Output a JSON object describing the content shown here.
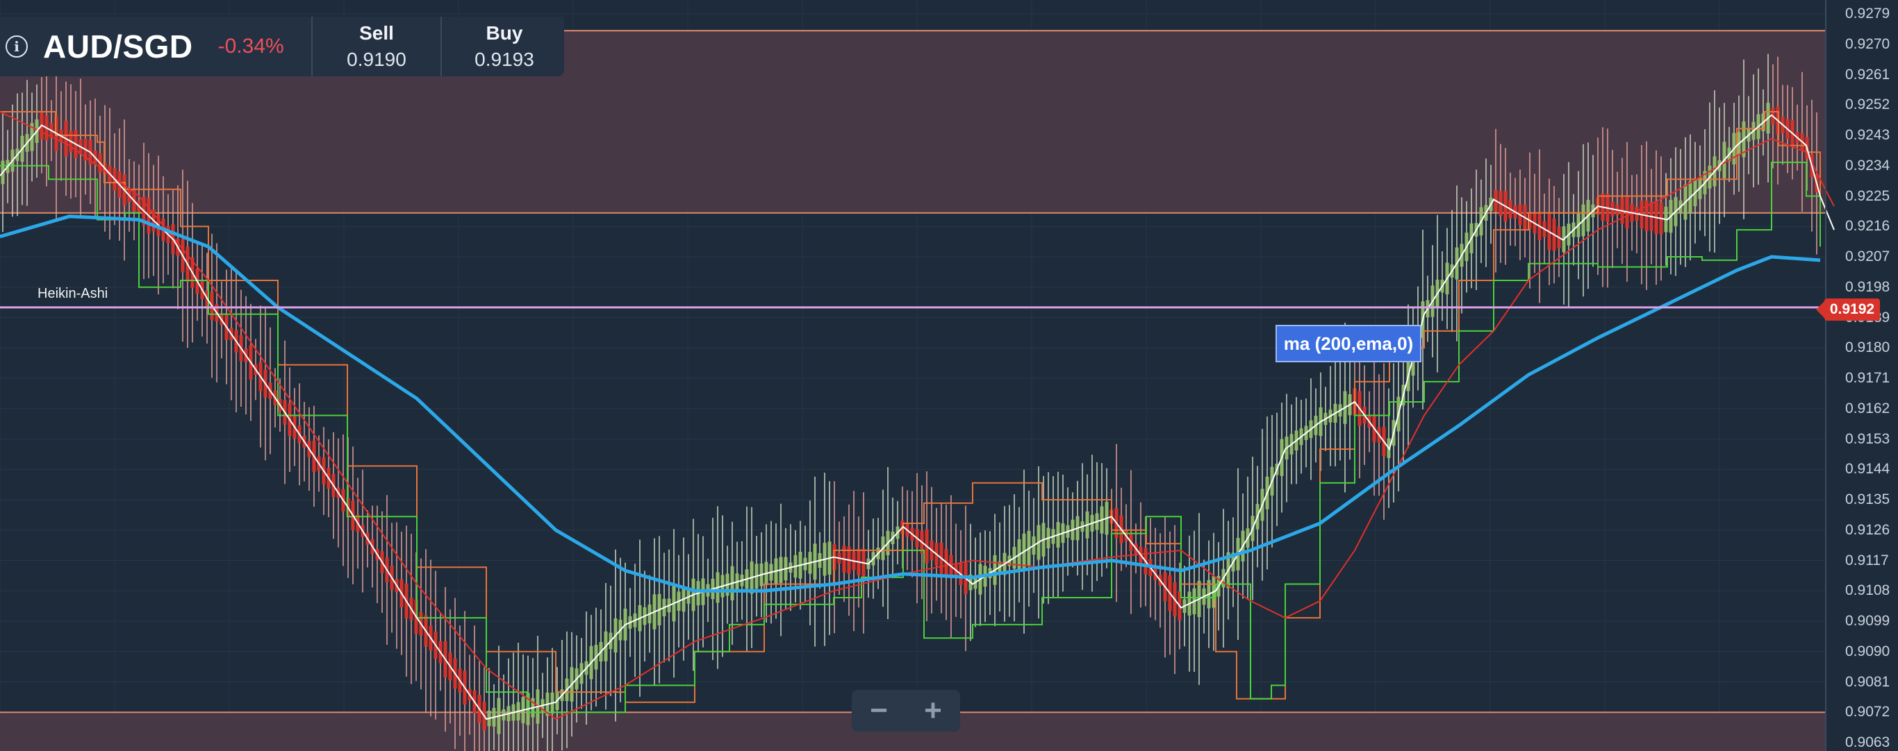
{
  "header": {
    "symbol": "AUD/SGD",
    "change": "-0.34%",
    "sell_label": "Sell",
    "sell_price": "0.9190",
    "buy_label": "Buy",
    "buy_price": "0.9193",
    "info_icon": "info-icon"
  },
  "study_label": "Heikin-Ashi",
  "tooltip": "ma (200,ema,0)",
  "current_price": "0.9192",
  "zoom": {
    "minus": "−",
    "plus": "+"
  },
  "colors": {
    "background": "#1e2b3a",
    "zone": "#4a3a46",
    "zone_line": "#e08a6a",
    "ema200": "#2ca8e8",
    "price_line": "#d8a2e8",
    "negative": "#ef4f5a",
    "candle_up": "#8fb86a",
    "candle_down": "#d8332a",
    "fast_ma": "#ffffff",
    "slow_ma": "#e0302b",
    "channel_low": "#4cd13a",
    "channel_high": "#e8743a"
  },
  "chart_data": {
    "type": "line",
    "title": "AUD/SGD",
    "y_ticks": [
      "0.9279",
      "0.9270",
      "0.9261",
      "0.9252",
      "0.9243",
      "0.9234",
      "0.9225",
      "0.9216",
      "0.9207",
      "0.9198",
      "0.9189",
      "0.9180",
      "0.9171",
      "0.9162",
      "0.9153",
      "0.9144",
      "0.9135",
      "0.9126",
      "0.9117",
      "0.9108",
      "0.9099",
      "0.9090",
      "0.9081",
      "0.9072",
      "0.9063"
    ],
    "ylim": [
      0.9062,
      0.928
    ],
    "horizontal_lines": {
      "zone_top": 0.9274,
      "zone_upper_edge": 0.922,
      "price_line": 0.9192,
      "zone_lower_edge": 0.9072
    },
    "series": [
      {
        "x": [
          0,
          100,
          200,
          300,
          400,
          600,
          800,
          900,
          1000,
          1100,
          1200,
          1300,
          1400,
          1500,
          1600,
          1700,
          1800,
          1900,
          2000,
          2100,
          2200,
          2300,
          2400,
          2500,
          2550,
          2620
        ],
        "values": [
          0.9213,
          0.9219,
          0.9218,
          0.921,
          0.9192,
          0.9165,
          0.9126,
          0.9114,
          0.9108,
          0.9108,
          0.911,
          0.9113,
          0.9112,
          0.9115,
          0.9117,
          0.9114,
          0.912,
          0.9128,
          0.9143,
          0.9157,
          0.9172,
          0.9183,
          0.9193,
          0.9203,
          0.9207,
          0.9206
        ]
      },
      {
        "x": [
          0,
          60,
          130,
          200,
          250,
          300,
          400,
          500,
          600,
          700,
          800,
          900,
          1000,
          1100,
          1200,
          1250,
          1300,
          1400,
          1500,
          1600,
          1700,
          1750,
          1800,
          1850,
          1900,
          1950,
          2000,
          2050,
          2100,
          2150,
          2200,
          2250,
          2300,
          2350,
          2400,
          2450,
          2500,
          2550,
          2600,
          2620,
          2640
        ],
        "values": [
          0.9231,
          0.9246,
          0.9238,
          0.9222,
          0.9212,
          0.9194,
          0.9164,
          0.9133,
          0.91,
          0.907,
          0.9075,
          0.9098,
          0.9107,
          0.9113,
          0.9118,
          0.9116,
          0.9127,
          0.911,
          0.9123,
          0.913,
          0.9103,
          0.9108,
          0.9125,
          0.915,
          0.9158,
          0.9164,
          0.915,
          0.919,
          0.9206,
          0.9224,
          0.9218,
          0.9212,
          0.9222,
          0.922,
          0.9218,
          0.9228,
          0.924,
          0.9249,
          0.924,
          0.9225,
          0.9215
        ]
      },
      {
        "x": [
          0,
          100,
          200,
          300,
          400,
          500,
          600,
          700,
          800,
          900,
          1000,
          1100,
          1200,
          1300,
          1400,
          1500,
          1600,
          1700,
          1750,
          1800,
          1850,
          1900,
          1950,
          2000,
          2050,
          2100,
          2150,
          2200,
          2300,
          2400,
          2500,
          2550,
          2600,
          2620,
          2640
        ],
        "values": [
          0.925,
          0.924,
          0.9225,
          0.92,
          0.917,
          0.914,
          0.911,
          0.9085,
          0.907,
          0.908,
          0.9093,
          0.91,
          0.9108,
          0.9113,
          0.9117,
          0.9115,
          0.9118,
          0.912,
          0.9112,
          0.9105,
          0.91,
          0.9105,
          0.912,
          0.914,
          0.916,
          0.9175,
          0.9185,
          0.92,
          0.9215,
          0.9225,
          0.9237,
          0.9242,
          0.9238,
          0.923,
          0.9222
        ]
      },
      {
        "x": [
          0,
          70,
          140,
          180,
          200,
          260,
          300,
          400,
          500,
          600,
          700,
          760,
          800,
          900,
          1000,
          1050,
          1100,
          1200,
          1240,
          1300,
          1330,
          1400,
          1500,
          1600,
          1650,
          1700,
          1750,
          1800,
          1830,
          1850,
          1900,
          1950,
          2000,
          2050,
          2100,
          2150,
          2200,
          2300,
          2400,
          2450,
          2500,
          2550,
          2600,
          2620
        ],
        "values": [
          0.9234,
          0.923,
          0.9218,
          0.922,
          0.9198,
          0.92,
          0.919,
          0.916,
          0.913,
          0.91,
          0.9078,
          0.9072,
          0.9072,
          0.908,
          0.909,
          0.9098,
          0.9104,
          0.9106,
          0.9112,
          0.912,
          0.9094,
          0.9098,
          0.9106,
          0.9125,
          0.913,
          0.9106,
          0.911,
          0.9076,
          0.908,
          0.911,
          0.914,
          0.916,
          0.9164,
          0.917,
          0.9185,
          0.92,
          0.9205,
          0.9204,
          0.9207,
          0.9206,
          0.9215,
          0.9235,
          0.9225,
          0.921
        ]
      },
      {
        "x": [
          0,
          80,
          140,
          150,
          180,
          260,
          300,
          400,
          500,
          600,
          700,
          800,
          900,
          1000,
          1100,
          1200,
          1300,
          1330,
          1400,
          1500,
          1600,
          1650,
          1700,
          1750,
          1780,
          1850,
          1900,
          1950,
          2000,
          2050,
          2100,
          2150,
          2200,
          2300,
          2400,
          2500,
          2540,
          2560,
          2600,
          2620
        ],
        "values": [
          0.925,
          0.9243,
          0.9241,
          0.9229,
          0.9227,
          0.9216,
          0.92,
          0.9175,
          0.9145,
          0.9115,
          0.909,
          0.9078,
          0.9075,
          0.909,
          0.911,
          0.912,
          0.9128,
          0.9134,
          0.914,
          0.9135,
          0.9126,
          0.9122,
          0.911,
          0.909,
          0.9076,
          0.91,
          0.915,
          0.917,
          0.918,
          0.9185,
          0.92,
          0.9215,
          0.922,
          0.9225,
          0.923,
          0.9245,
          0.925,
          0.924,
          0.9238,
          0.9225
        ]
      }
    ]
  }
}
